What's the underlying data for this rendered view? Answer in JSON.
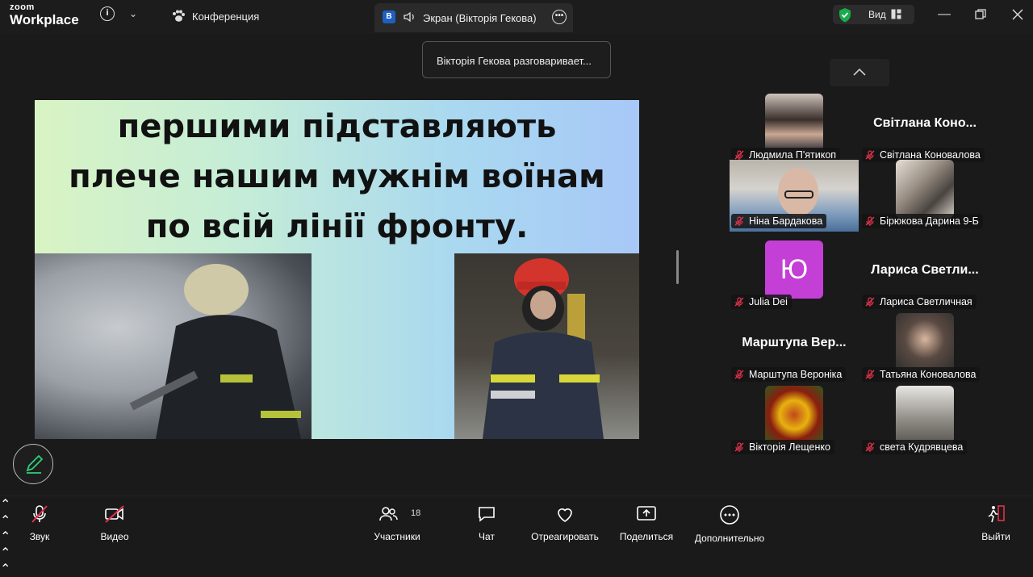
{
  "app": {
    "brand_small": "zoom",
    "brand_large": "Workplace"
  },
  "topbar": {
    "meeting_title": "Конференция",
    "share_tab_badge": "B",
    "share_tab_label": "Экран (Вікторія Гекова)",
    "view_label": "Вид"
  },
  "toast": {
    "text": "Вікторія Гекова разговаривает..."
  },
  "slide": {
    "lines": [
      "першими підставляють",
      "плече нашим мужнім воїнам",
      "по всій лінії фронту."
    ]
  },
  "participants": [
    {
      "name": "Людмила П'ятикоп",
      "display": "",
      "kind": "photo"
    },
    {
      "name": "Світлана Коновалова",
      "display": "Світлана Коно...",
      "kind": "name"
    },
    {
      "name": "Ніна Бардакова",
      "display": "",
      "kind": "video"
    },
    {
      "name": "Бірюкова Дарина 9-Б",
      "display": "",
      "kind": "photo"
    },
    {
      "name": "Julia Dei",
      "display": "Ю",
      "kind": "letter"
    },
    {
      "name": "Лариса Светличная",
      "display": "Лариса Светли...",
      "kind": "name"
    },
    {
      "name": "Марштупа Вероніка",
      "display": "Марштупа Вер...",
      "kind": "name"
    },
    {
      "name": "Татьяна Коновалова",
      "display": "",
      "kind": "photo"
    },
    {
      "name": "Вікторія Лещенко",
      "display": "",
      "kind": "photo"
    },
    {
      "name": "света Кудрявцева",
      "display": "",
      "kind": "photo"
    }
  ],
  "toolbar": {
    "audio": "Звук",
    "video": "Видео",
    "participants": "Участники",
    "participants_count": "18",
    "chat": "Чат",
    "react": "Отреагировать",
    "share": "Поделиться",
    "more": "Дополнительно",
    "leave": "Выйти"
  },
  "colors": {
    "accent_green": "#1aab4b",
    "letter_avatar": "#c43fd6",
    "leave_red": "#e0324a"
  }
}
